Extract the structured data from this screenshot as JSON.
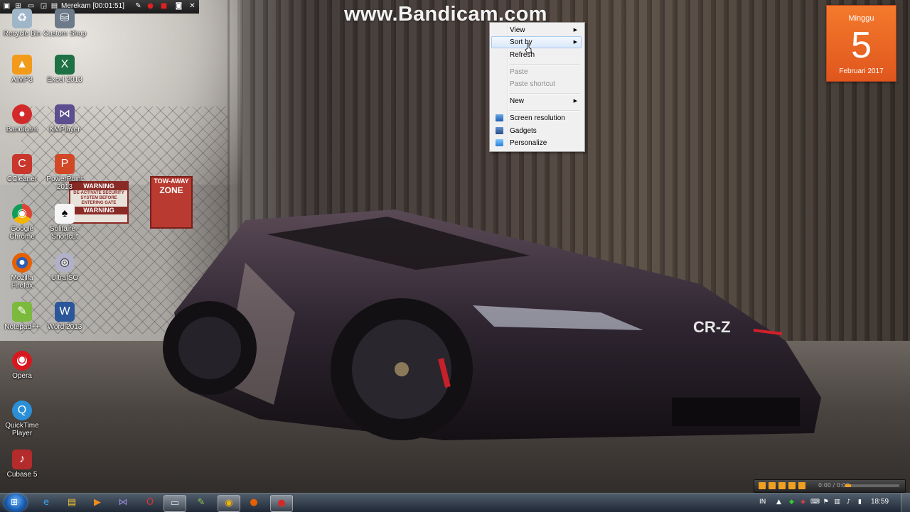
{
  "watermark": "www.Bandicam.com",
  "recording_bar": {
    "title": "Merekam [00:01:51]"
  },
  "desktop_icons": [
    {
      "label": "Recycle Bin",
      "icon": "recycle-bin-icon"
    },
    {
      "label": "Custom Shop",
      "icon": "custom-shop-icon"
    },
    {
      "label": "AIMP3",
      "icon": "aimp3-icon"
    },
    {
      "label": "Excel 2013",
      "icon": "excel-icon"
    },
    {
      "label": "Bandicam",
      "icon": "bandicam-icon"
    },
    {
      "label": "KMPlayer",
      "icon": "kmplayer-icon"
    },
    {
      "label": "CCleaner",
      "icon": "ccleaner-icon"
    },
    {
      "label": "PowerPoint 2013",
      "icon": "powerpoint-icon"
    },
    {
      "label": "Google Chrome",
      "icon": "chrome-icon"
    },
    {
      "label": "Solitaire - Shortcut",
      "icon": "solitaire-icon"
    },
    {
      "label": "Mozilla Firefox",
      "icon": "firefox-icon"
    },
    {
      "label": "UltraISO",
      "icon": "ultraiso-icon"
    },
    {
      "label": "Notepad++",
      "icon": "notepadpp-icon"
    },
    {
      "label": "Word 2013",
      "icon": "word-icon"
    },
    {
      "label": "Opera",
      "icon": "opera-icon"
    },
    {
      "label": "QuickTime Player",
      "icon": "quicktime-icon"
    },
    {
      "label": "Cubase 5",
      "icon": "cubase-icon"
    }
  ],
  "context_menu": {
    "items": [
      {
        "label": "View",
        "submenu": true
      },
      {
        "label": "Sort by",
        "submenu": true,
        "highlighted": true
      },
      {
        "label": "Refresh"
      },
      {
        "label": "Paste",
        "disabled": true
      },
      {
        "label": "Paste shortcut",
        "disabled": true
      },
      {
        "label": "New",
        "submenu": true
      },
      {
        "label": "Screen resolution",
        "icon": "screen-resolution-icon"
      },
      {
        "label": "Gadgets",
        "icon": "gadgets-icon"
      },
      {
        "label": "Personalize",
        "icon": "personalize-icon"
      }
    ]
  },
  "calendar": {
    "day": "Minggu",
    "date": "5",
    "month_year": "Februari 2017"
  },
  "wallpaper_signs": {
    "warning_top": "WARNING",
    "warning_body": "DE-ACTIVATE SECURITY SYSTEM BEFORE ENTERING GATE",
    "warning_bottom": "WARNING",
    "towaway_top": "TOW-AWAY",
    "towaway_zone": "ZONE",
    "car_badge": "CR-Z"
  },
  "mini_player": {
    "time": "0:00 / 0:00",
    "progress": 0.1
  },
  "taskbar": {
    "pinned": [
      {
        "name": "ie",
        "icon": "internet-explorer-icon"
      },
      {
        "name": "explorer",
        "icon": "folder-icon"
      },
      {
        "name": "media",
        "icon": "media-player-icon"
      },
      {
        "name": "kmplayer",
        "icon": "kmplayer-icon"
      },
      {
        "name": "opera",
        "icon": "opera-icon"
      },
      {
        "name": "notepad",
        "icon": "notepad-icon",
        "active": true
      },
      {
        "name": "notepadpp",
        "icon": "notepadpp-icon"
      },
      {
        "name": "chrome",
        "icon": "chrome-icon",
        "active": true
      },
      {
        "name": "firefox",
        "icon": "firefox-icon"
      },
      {
        "name": "bandicam",
        "icon": "bandicam-icon",
        "active": true
      }
    ],
    "language": "IN",
    "clock": "18:59"
  }
}
